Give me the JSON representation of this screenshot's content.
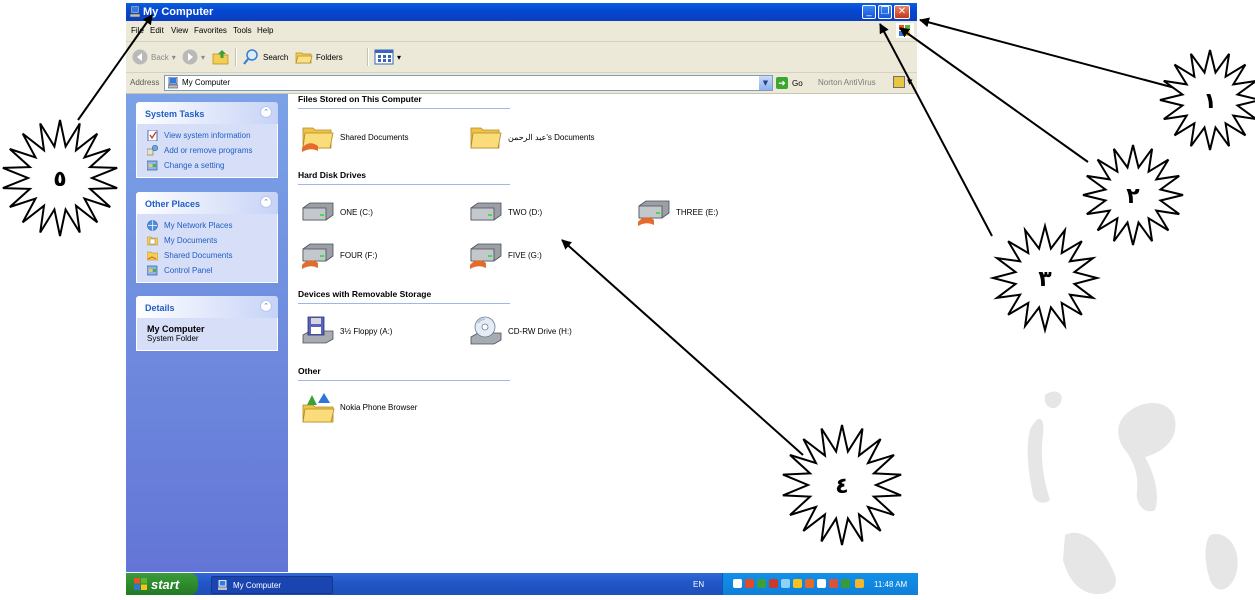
{
  "window": {
    "title": "My Computer",
    "caption_buttons": {
      "minimize": "_",
      "restore": "❐",
      "close": "✕"
    }
  },
  "menubar": [
    "File",
    "Edit",
    "View",
    "Favorites",
    "Tools",
    "Help"
  ],
  "toolbar": {
    "back_label": "Back",
    "search_label": "Search",
    "folders_label": "Folders"
  },
  "addressbar": {
    "label": "Address",
    "value": "My Computer",
    "go_label": "Go",
    "norton_label": "Norton AntiVirus"
  },
  "taskpane": {
    "system_tasks": {
      "title": "System Tasks",
      "items": [
        "View system information",
        "Add or remove programs",
        "Change a setting"
      ]
    },
    "other_places": {
      "title": "Other Places",
      "items": [
        "My Network Places",
        "My Documents",
        "Shared Documents",
        "Control Panel"
      ]
    },
    "details": {
      "title": "Details",
      "name": "My Computer",
      "type": "System Folder"
    }
  },
  "content": {
    "files_section": "Files Stored on This Computer",
    "files": [
      "Shared Documents",
      "عبد الرحمن's Documents"
    ],
    "drives_section": "Hard Disk Drives",
    "drives": [
      "ONE (C:)",
      "TWO (D:)",
      "THREE (E:)",
      "FOUR (F:)",
      "FIVE (G:)"
    ],
    "removable_section": "Devices with Removable Storage",
    "removable": [
      "3½ Floppy (A:)",
      "CD-RW Drive (H:)"
    ],
    "other_section": "Other",
    "other": [
      "Nokia Phone Browser"
    ]
  },
  "taskbar": {
    "start_label": "start",
    "task_label": "My Computer",
    "language": "EN",
    "clock": "11:48 AM"
  },
  "annotations": {
    "labels": [
      "١",
      "٢",
      "٣",
      "٤",
      "٥"
    ]
  },
  "colors": {
    "titlebar": "#0a5fe0",
    "taskpane": "#7ba2e7",
    "link": "#215dc6",
    "close_button": "#d9532f"
  }
}
